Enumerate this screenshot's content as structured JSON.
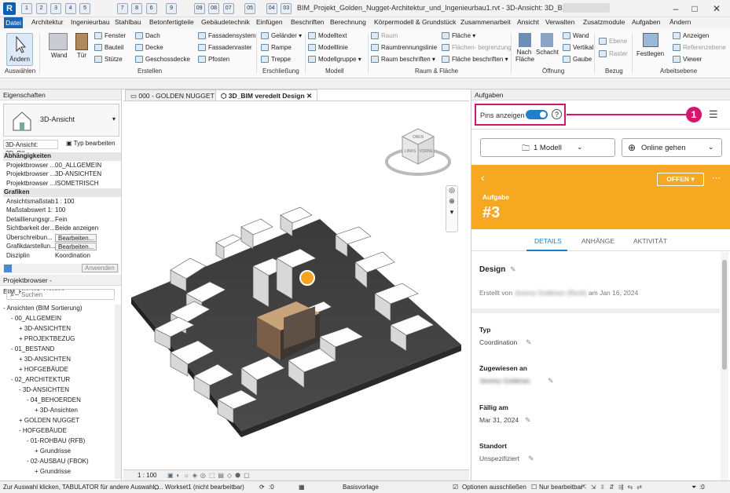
{
  "titlebar": {
    "title": "BIM_Projekt_Golden_Nugget-Architektur_und_Ingenieurbau1.rvt - 3D-Ansicht: 3D_BIM vere...",
    "keytips": [
      "1",
      "2",
      "3",
      "4",
      "5",
      "7",
      "8",
      "6",
      "9",
      "0",
      "Q",
      "W",
      "R",
      "T",
      "Y",
      "U",
      "8",
      "E"
    ],
    "qa_labels": [
      "1",
      "2",
      "3",
      "4",
      "5",
      "7",
      "8",
      "6",
      "9",
      "09",
      "08",
      "07",
      "05",
      "04",
      "03",
      "02"
    ]
  },
  "menubar": {
    "items": [
      "Datei",
      "Architektur",
      "Ingenieurbau",
      "Stahlbau",
      "Betonfertigteile",
      "Gebäudetechnik",
      "Einfügen",
      "Beschriften",
      "Berechnung",
      "Körpermodell & Grundstück",
      "Zusammenarbeit",
      "Ansicht",
      "Verwalten",
      "Zusatzmodule",
      "Aufgaben",
      "Ändern"
    ]
  },
  "ribbon": {
    "aendern": "Ändern",
    "auswaehlen": "Auswählen",
    "wand": "Wand",
    "tuer": "Tür",
    "fenster": "Fenster",
    "bauteil": "Bauteil",
    "stuetze": "Stütze",
    "dach": "Dach",
    "decke": "Decke",
    "geschossdecke": "Geschossdecke",
    "fassadensystem": "Fassadensystem",
    "fassadenraster": "Fassadenraster",
    "pfosten": "Pfosten",
    "erstellen": "Erstellen",
    "gelaender": "Geländer",
    "rampe": "Rampe",
    "treppe": "Treppe",
    "erschliessung": "Erschließung",
    "modelltext": "Modelltext",
    "modelllinie": "Modelllinie",
    "modellgruppe": "Modellgruppe",
    "modell": "Modell",
    "raum": "Raum",
    "raumtrennungslinie": "Raumtrennungslinie",
    "raum_beschriften": "Raum  beschriften",
    "flaeche": "Fläche",
    "flaechenbegrenzung": "Flächen- begrenzung",
    "flaeche_beschriften": "Fläche  beschriften",
    "raum_flaeche": "Raum & Fläche",
    "nach_flaeche": "Nach Fläche",
    "schacht": "Schacht",
    "wand2": "Wand",
    "vertikal": "Vertikal",
    "gaube": "Gaube",
    "oeffnung": "Öffnung",
    "ebene": "Ebene",
    "raster": "Raster",
    "bezug": "Bezug",
    "festlegen": "Festlegen",
    "anzeigen": "Anzeigen",
    "referenzebene": "Referenzebene",
    "viewer": "Viewer",
    "arbeitsebene": "Arbeitsebene"
  },
  "properties": {
    "title": "Eigenschaften",
    "type_name": "3D-Ansicht",
    "selector": "3D-Ansicht: 3D_BII",
    "type_edit": "Typ bearbeiten",
    "rows": [
      {
        "cat": "Abhängigkeiten"
      },
      {
        "k": "Projektbrowser ...",
        "v": "00_ALLGEMEIN"
      },
      {
        "k": "Projektbrowser ...",
        "v": "3D-ANSICHTEN"
      },
      {
        "k": "Projektbrowser ...",
        "v": "ISOMETRISCH"
      },
      {
        "cat": "Grafiken"
      },
      {
        "k": "Ansichtsmaßstab",
        "v": "1 : 100"
      },
      {
        "k": "Maßstabswert 1:",
        "v": "100"
      },
      {
        "k": "Detaillierungsgr...",
        "v": "Fein"
      },
      {
        "k": "Sichtbarkeit der...",
        "v": "Beide anzeigen"
      },
      {
        "k": "Überschreibun...",
        "v": "Bearbeiten..."
      },
      {
        "k": "Grafikdarstellun...",
        "v": "Bearbeiten..."
      },
      {
        "k": "Disziplin",
        "v": "Koordination"
      }
    ],
    "anwenden": "Anwenden"
  },
  "browser": {
    "title": "Projektbrowser - BIM_Projekt_Golden_...",
    "search_placeholder": "Suchen",
    "tree": [
      {
        "t": "Ansichten (BIM Sortierung)",
        "d": 0,
        "s": "-"
      },
      {
        "t": "00_ALLGEMEIN",
        "d": 1,
        "s": "-"
      },
      {
        "t": "3D-ANSICHTEN",
        "d": 2,
        "s": "+"
      },
      {
        "t": "PROJEKTBEZUG",
        "d": 2,
        "s": "+"
      },
      {
        "t": "01_BESTAND",
        "d": 1,
        "s": "-"
      },
      {
        "t": "3D-ANSICHTEN",
        "d": 2,
        "s": "+"
      },
      {
        "t": "HOFGEBÄUDE",
        "d": 2,
        "s": "+"
      },
      {
        "t": "02_ARCHITEKTUR",
        "d": 1,
        "s": "-"
      },
      {
        "t": "3D-ANSICHTEN",
        "d": 2,
        "s": "-"
      },
      {
        "t": "04_BEHOERDEN",
        "d": 3,
        "s": "-"
      },
      {
        "t": "3D-Ansichten",
        "d": 4,
        "s": "+"
      },
      {
        "t": "GOLDEN NUGGET",
        "d": 2,
        "s": "+"
      },
      {
        "t": "HOFGEBÄUDE",
        "d": 2,
        "s": "-"
      },
      {
        "t": "01-ROHBAU (RFB)",
        "d": 3,
        "s": "-"
      },
      {
        "t": "Grundrisse",
        "d": 4,
        "s": "+"
      },
      {
        "t": "02-AUSBAU (FBOK)",
        "d": 3,
        "s": "-"
      },
      {
        "t": "Grundrisse",
        "d": 4,
        "s": "+"
      }
    ]
  },
  "canvas": {
    "tabs": [
      "000 - GOLDEN NUGGET",
      "3D_BIM veredelt Design"
    ],
    "viewcube": {
      "top": "OBEN",
      "left": "LINKS",
      "front": "VORNE"
    },
    "scale": "1 : 100"
  },
  "aufgaben": {
    "title": "Aufgaben",
    "pins_label": "Pins anzeigen",
    "pins_on": true,
    "callout": "1",
    "modell": "1 Modell",
    "online": "Online gehen",
    "header_color": "#f6a821",
    "highlight_color": "#d4166f",
    "aufgabe_label": "Aufgabe",
    "number": "#3",
    "status": "OFFEN",
    "tabs": [
      "DETAILS",
      "ANHÄNGE",
      "AKTIVITÄT"
    ],
    "design_label": "Design",
    "created_prefix": "Erstellt von",
    "created_by": "Jeremy Goldman (Revit)",
    "created_suffix": "am Jan 16, 2024",
    "typ_label": "Typ",
    "typ_value": "Coordination",
    "zugewiesen_label": "Zugewiesen an",
    "zugewiesen_value": "Jeremy Goldman",
    "faellig_label": "Fällig am",
    "faellig_value": "Mar 31, 2024",
    "standort_label": "Standort",
    "standort_value": "Unspezifiziert"
  },
  "status": {
    "hint": "Zur Auswahl klicken, TABULATOR für andere Auswahl, ...",
    "workset": "Workset1 (nicht bearbeitbar)",
    "zero": ":0",
    "basisvorlage": "Basisvorlage",
    "optionen": "Optionen ausschließen",
    "nur_bearbeitbar": "Nur bearbeitbar",
    "filter_count": ":0"
  }
}
